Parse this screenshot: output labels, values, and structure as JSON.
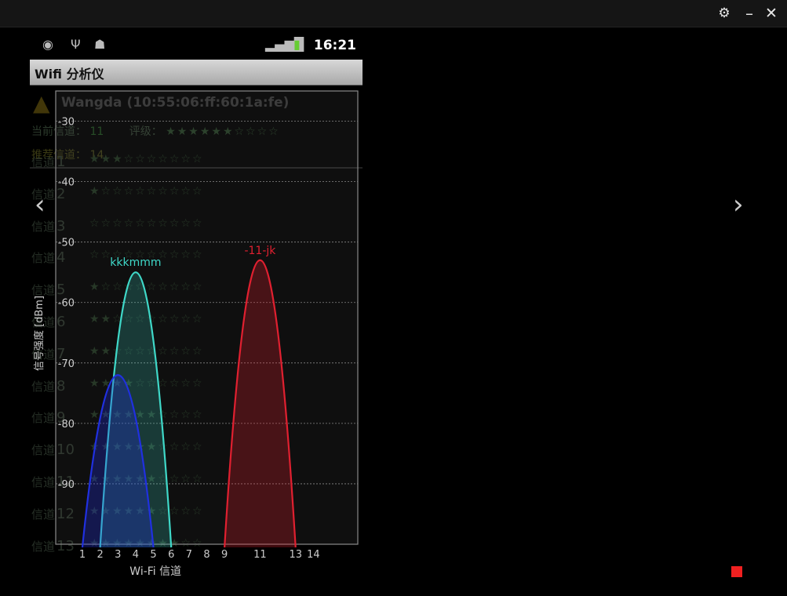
{
  "window": {
    "settings_icon": "gear-icon",
    "minimize_label": "–",
    "close_label": "✕"
  },
  "status_bar": {
    "time": "16:21",
    "icons": [
      "notification-icon",
      "usb-icon",
      "android-debug-icon",
      "signal-icon",
      "battery-charging-icon"
    ]
  },
  "app": {
    "title": "Wifi 分析仪"
  },
  "background": {
    "ap_name": "Wangda (10:55:06:ff:60:1a:fe)",
    "current_channel_label": "当前信道：",
    "current_channel_value": "11",
    "rating_label": "评级：",
    "recommended_label": "推荐信道：",
    "recommended_value": "14",
    "channel_rows": [
      {
        "label": "信道",
        "num": "1",
        "stars": "★★★☆☆☆☆☆☆☆"
      },
      {
        "label": "信道",
        "num": "2",
        "stars": "★☆☆☆☆☆☆☆☆☆"
      },
      {
        "label": "信道",
        "num": "3",
        "stars": "☆☆☆☆☆☆☆☆☆☆"
      },
      {
        "label": "信道",
        "num": "4",
        "stars": "☆☆☆☆☆☆☆☆☆☆"
      },
      {
        "label": "信道",
        "num": "5",
        "stars": "★☆☆☆☆☆☆☆☆☆"
      },
      {
        "label": "信道",
        "num": "6",
        "stars": "★★☆☆☆☆☆☆☆☆"
      },
      {
        "label": "信道",
        "num": "7",
        "stars": "★★☆☆☆☆☆☆☆☆"
      },
      {
        "label": "信道",
        "num": "8",
        "stars": "★★★★☆☆☆☆☆☆"
      },
      {
        "label": "信道",
        "num": "9",
        "stars": "★★★★★★☆☆☆☆"
      },
      {
        "label": "信道",
        "num": "10",
        "stars": "★★★★★★☆☆☆☆"
      },
      {
        "label": "信道",
        "num": "11",
        "stars": "★★★★★★☆☆☆☆"
      },
      {
        "label": "信道",
        "num": "12",
        "stars": "★★★★★★☆☆☆☆"
      },
      {
        "label": "信道",
        "num": "13",
        "stars": "★★★★★★★★☆☆"
      }
    ]
  },
  "navigation": {
    "prev_label": "‹",
    "next_label": "›"
  },
  "chart_data": {
    "type": "area",
    "xlabel": "Wi-Fi 信道",
    "ylabel": "信号强度 [dBm]",
    "x_ticks": [
      "1",
      "2",
      "3",
      "4",
      "5",
      "6",
      "7",
      "8",
      "9",
      "11",
      "13",
      "14"
    ],
    "x_tick_values": [
      1,
      2,
      3,
      4,
      5,
      6,
      7,
      8,
      9,
      11,
      13,
      14
    ],
    "y_ticks": [
      -30,
      -40,
      -50,
      -60,
      -70,
      -80,
      -90
    ],
    "xlim": [
      -0.5,
      16.5
    ],
    "ylim": [
      -100,
      -25
    ],
    "grid": true,
    "series": [
      {
        "name": "kkkmmm",
        "center": 4,
        "left": 2,
        "right": 6,
        "peak": -55,
        "color": "#3fd8c8",
        "show_label": true
      },
      {
        "name": "",
        "center": 3,
        "left": 1,
        "right": 5,
        "peak": -72,
        "color": "#2030e0",
        "show_label": false
      },
      {
        "name": "-11-jk",
        "center": 11,
        "left": 9,
        "right": 13,
        "peak": -53,
        "color": "#e02030",
        "show_label": true
      }
    ]
  },
  "indicator": {
    "record_color": "#f02020"
  }
}
